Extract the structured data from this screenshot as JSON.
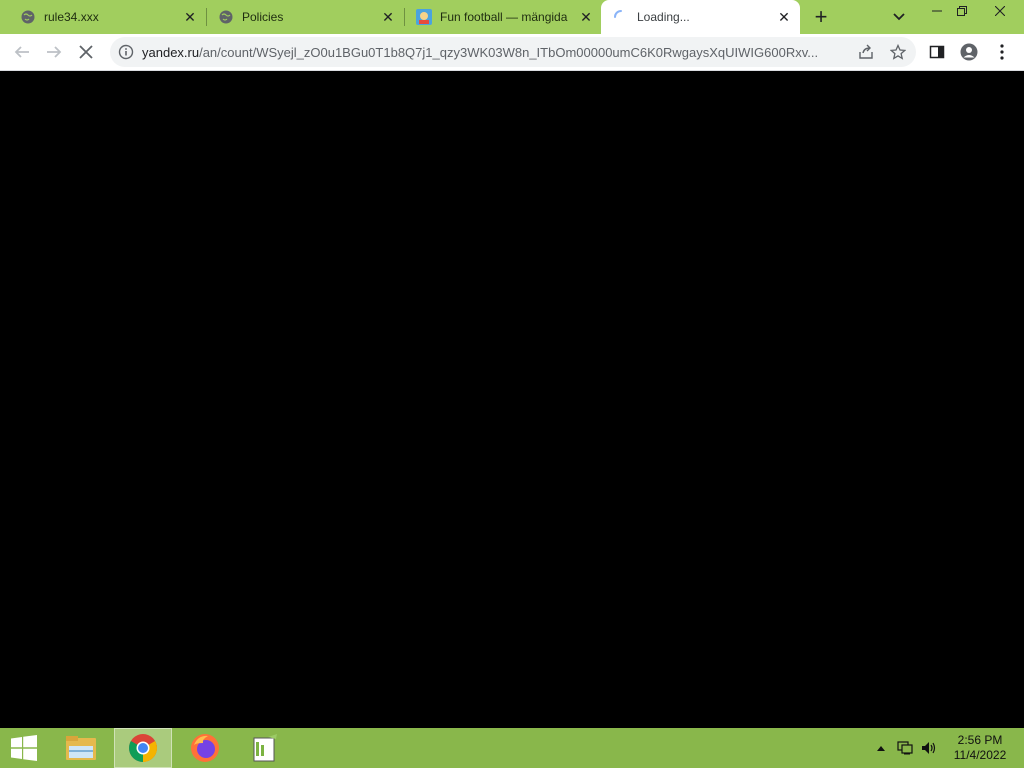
{
  "browser": {
    "tabs": [
      {
        "title": "rule34.xxx",
        "favicon": "globe-icon",
        "active": false
      },
      {
        "title": "Policies",
        "favicon": "globe-icon",
        "active": false
      },
      {
        "title": "Fun football — mängida",
        "favicon": "game-icon",
        "active": false
      },
      {
        "title": "Loading...",
        "favicon": "loading-spinner-icon",
        "active": true
      }
    ],
    "url": {
      "host": "yandex.ru",
      "path": "/an/count/WSyejl_zO0u1BGu0T1b8Q7j1_qzy3WK03W8n_ITbOm00000umC6K0RwgaysXqUIWIG600Rxv..."
    },
    "theme_color": "#a1ce5e"
  },
  "taskbar": {
    "apps": [
      {
        "name": "file-explorer-icon",
        "active": false
      },
      {
        "name": "chrome-icon",
        "active": true
      },
      {
        "name": "firefox-icon",
        "active": false
      },
      {
        "name": "notepad-plus-plus-icon",
        "active": false
      }
    ],
    "clock": {
      "time": "2:56 PM",
      "date": "11/4/2022"
    },
    "color": "#89b74b"
  }
}
